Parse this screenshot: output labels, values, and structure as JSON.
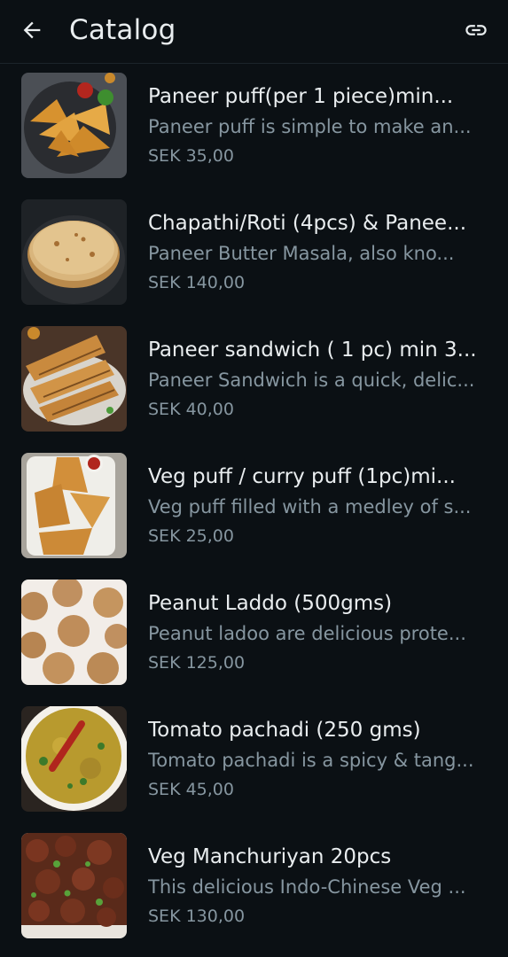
{
  "header": {
    "title": "Catalog",
    "back_icon": "arrow-left-icon",
    "link_icon": "link-icon"
  },
  "colors": {
    "background": "#0b1014",
    "primary_text": "#e9edef",
    "secondary_text": "#8696a0"
  },
  "products": [
    {
      "name": "Paneer puff(per 1 piece)min...",
      "description": "Paneer puff is simple to make an...",
      "price": "SEK 35,00",
      "image": "paneer-puff-photo"
    },
    {
      "name": "Chapathi/Roti (4pcs) & Panee...",
      "description": "Paneer Butter Masala, also kno...",
      "price": "SEK 140,00",
      "image": "chapathi-roti-photo"
    },
    {
      "name": "Paneer sandwich ( 1 pc) min 3...",
      "description": "Paneer Sandwich is a quick, delic...",
      "price": "SEK 40,00",
      "image": "paneer-sandwich-photo"
    },
    {
      "name": "Veg puff / curry puff (1pc)mi...",
      "description": "Veg puff filled with a medley of s...",
      "price": "SEK 25,00",
      "image": "veg-puff-photo"
    },
    {
      "name": "Peanut Laddo (500gms)",
      "description": "Peanut ladoo are delicious prote...",
      "price": "SEK 125,00",
      "image": "peanut-laddo-photo"
    },
    {
      "name": "Tomato pachadi (250 gms)",
      "description": "Tomato pachadi is a spicy & tang...",
      "price": "SEK 45,00",
      "image": "tomato-pachadi-photo"
    },
    {
      "name": "Veg Manchuriyan 20pcs",
      "description": "This delicious Indo-Chinese Veg ...",
      "price": "SEK 130,00",
      "image": "veg-manchuriyan-photo"
    }
  ]
}
